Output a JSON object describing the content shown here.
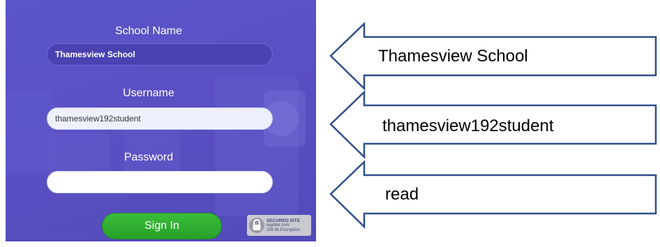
{
  "login_form": {
    "school_name_label": "School Name",
    "school_name_value": "Thamesview School",
    "username_label": "Username",
    "username_value": "thamesview192student",
    "password_label": "Password",
    "password_value": "",
    "sign_in_label": "Sign In",
    "badge": {
      "line1": "SECURED SITE",
      "line2": "register.com",
      "line3": "256 bit Encryption",
      "icon": "padlock-icon"
    }
  },
  "annotations": {
    "school_name": "Thamesview School",
    "username": "thamesview192student",
    "password": "read"
  },
  "colors": {
    "panel_purple": "#5a50c4",
    "sign_in_green": "#2db02f",
    "arrow_outline": "#2f4f8a"
  }
}
